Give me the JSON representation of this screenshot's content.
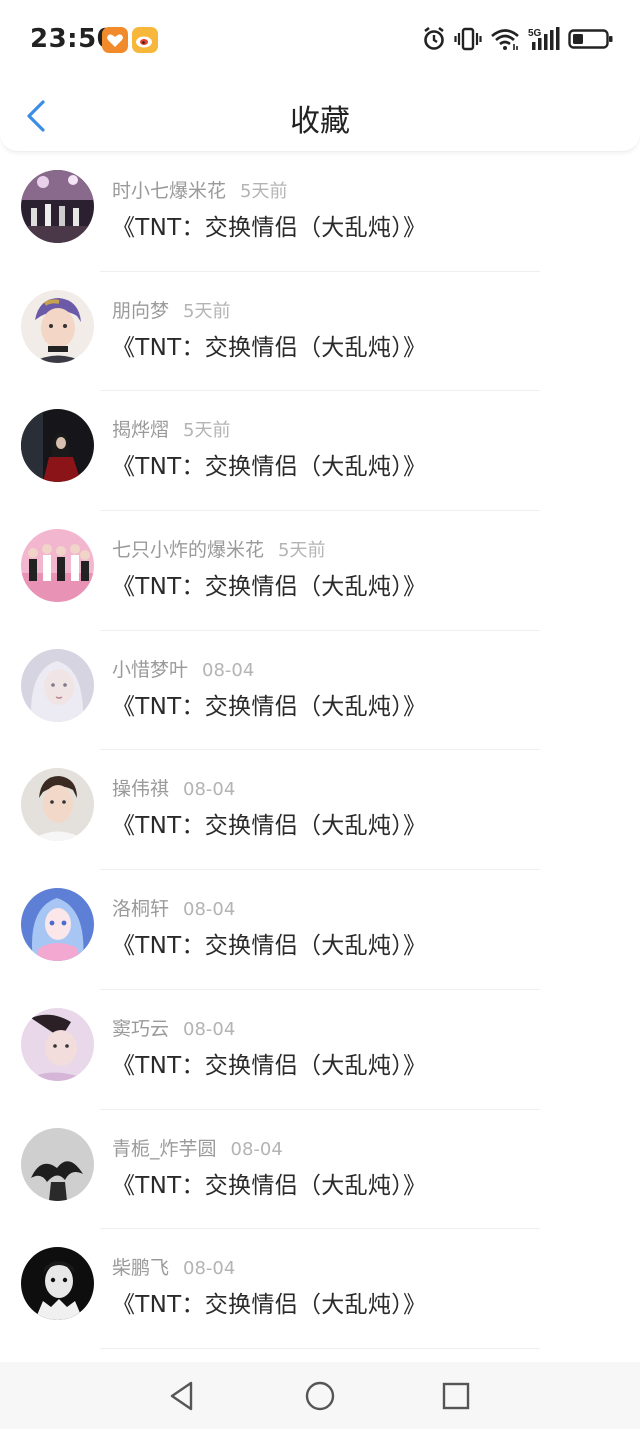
{
  "status": {
    "time": "23:50",
    "network": "5G"
  },
  "header": {
    "title": "收藏"
  },
  "items": [
    {
      "user": "时小七爆米花",
      "time": "5天前",
      "title": "《TNT：交换情侣（大乱炖）》"
    },
    {
      "user": "朋向梦",
      "time": "5天前",
      "title": "《TNT：交换情侣（大乱炖）》"
    },
    {
      "user": "揭烨熠",
      "time": "5天前",
      "title": "《TNT：交换情侣（大乱炖）》"
    },
    {
      "user": "七只小炸的爆米花",
      "time": "5天前",
      "title": "《TNT：交换情侣（大乱炖）》"
    },
    {
      "user": "小惜梦叶",
      "time": "08-04",
      "title": "《TNT：交换情侣（大乱炖）》"
    },
    {
      "user": "操伟祺",
      "time": "08-04",
      "title": "《TNT：交换情侣（大乱炖）》"
    },
    {
      "user": "洛桐轩",
      "time": "08-04",
      "title": "《TNT：交换情侣（大乱炖）》"
    },
    {
      "user": "窦巧云",
      "time": "08-04",
      "title": "《TNT：交换情侣（大乱炖）》"
    },
    {
      "user": "青栀_炸芋圆",
      "time": "08-04",
      "title": "《TNT：交换情侣（大乱炖）》"
    },
    {
      "user": "柴鹏飞",
      "time": "08-04",
      "title": "《TNT：交换情侣（大乱炖）》"
    }
  ],
  "colors": {
    "accent": "#3a8ee6",
    "muted_text": "#9a9a9a"
  },
  "icons": [
    "back-arrow-icon",
    "alarm-icon",
    "vibrate-icon",
    "wifi-icon",
    "signal-icon",
    "battery-icon",
    "nav-back-icon",
    "nav-home-icon",
    "nav-recents-icon"
  ]
}
